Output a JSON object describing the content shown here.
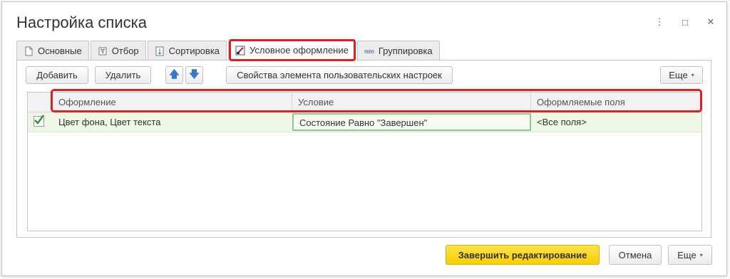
{
  "window": {
    "title": "Настройка списка",
    "controls": {
      "menu": "⋮",
      "maximize": "□",
      "close": "✕"
    }
  },
  "tabs": [
    {
      "label": "Основные",
      "icon": "document-icon"
    },
    {
      "label": "Отбор",
      "icon": "filter-icon"
    },
    {
      "label": "Сортировка",
      "icon": "sort-icon"
    },
    {
      "label": "Условное оформление",
      "icon": "conditional-format-icon",
      "active": true
    },
    {
      "label": "Группировка",
      "icon": "grouping-icon"
    }
  ],
  "toolbar": {
    "add_label": "Добавить",
    "delete_label": "Удалить",
    "move_up_icon": "arrow-up-icon",
    "move_down_icon": "arrow-down-icon",
    "properties_label": "Свойства элемента пользовательских настроек",
    "more_label": "Еще"
  },
  "grid": {
    "columns": [
      "Оформление",
      "Условие",
      "Оформляемые поля"
    ],
    "rows": [
      {
        "checked": true,
        "appearance": "Цвет фона, Цвет текста",
        "condition": "Состояние Равно \"Завершен\"",
        "fields": "<Все поля>"
      }
    ]
  },
  "footer": {
    "finish_label": "Завершить редактирование",
    "cancel_label": "Отмена",
    "more_label": "Еще"
  },
  "colors": {
    "accent_yellow": "#f6cf00",
    "highlight_red": "#e02020",
    "row_green": "#eef7e6",
    "check_green": "#2f9a2f",
    "arrow_blue": "#3a78c8"
  }
}
